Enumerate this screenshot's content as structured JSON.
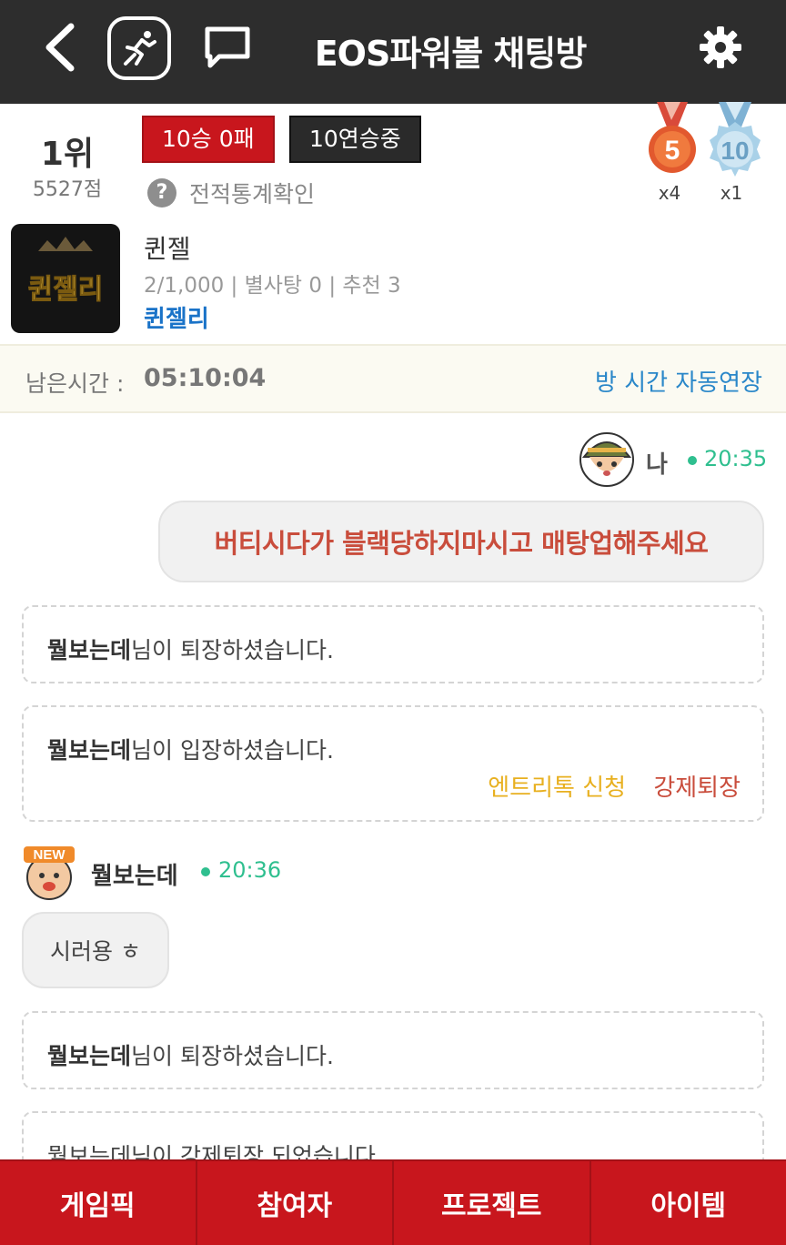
{
  "header": {
    "title": "EOS파워볼 채팅방",
    "icons": [
      "back-icon",
      "running-icon",
      "chat-bubble-icon",
      "gear-icon"
    ]
  },
  "profile": {
    "rank": "1위",
    "score": "5527점",
    "record_badge": "10승 0패",
    "streak_badge": "10연승중",
    "stats_link": "전적통계확인",
    "medals": [
      {
        "label": "5",
        "count": "x4",
        "color": "#d9532c"
      },
      {
        "label": "10",
        "count": "x1",
        "color": "#8fbfdc"
      }
    ]
  },
  "room": {
    "name": "퀸젤",
    "meta": "2/1,000 | 별사탕 0 | 추천 3",
    "owner": "퀸젤리",
    "thumb_text": "퀸젤리"
  },
  "timer": {
    "label": "남은시간 :",
    "value": "05:10:04",
    "extend": "방 시간 자동연장"
  },
  "chat": {
    "me": {
      "name": "나",
      "time": "20:35",
      "message": "버티시다가 블랙당하지마시고 매탕업해주세요"
    },
    "notices": [
      {
        "user": "뭘보는데",
        "text": "님이 퇴장하셨습니다."
      },
      {
        "user": "뭘보는데",
        "text": "님이 입장하셨습니다.",
        "action_entry": "엔트리톡 신청",
        "action_kick": "강제퇴장"
      },
      {
        "user": "뭘보는데",
        "text": "님이 퇴장하셨습니다."
      },
      {
        "user": "",
        "text": "뭘보는데님이 강제퇴장 되었습니다."
      }
    ],
    "other": {
      "name": "뭘보는데",
      "time": "20:36",
      "message": "시러용 ㅎ",
      "badge": "NEW"
    }
  },
  "bottom_nav": {
    "items": [
      "게임픽",
      "참여자",
      "프로젝트",
      "아이템"
    ]
  },
  "colors": {
    "topbar": "#2d2d2d",
    "accent_red": "#c8161d",
    "online_green": "#2fbf8f",
    "link_blue": "#1a73c8"
  }
}
